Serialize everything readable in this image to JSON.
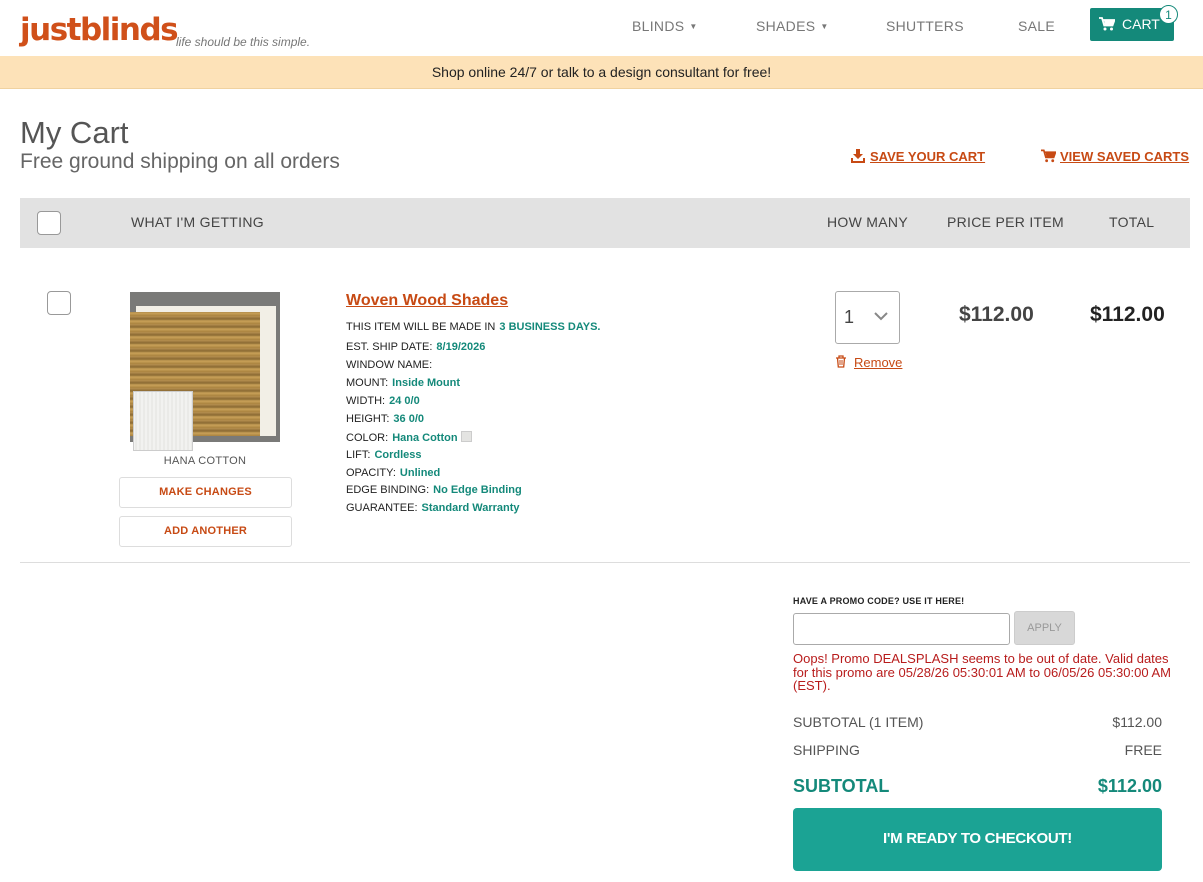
{
  "header": {
    "logo": "justblinds",
    "tagline": "life should be this simple.",
    "nav": [
      "BLINDS",
      "SHADES",
      "SHUTTERS",
      "SALE"
    ],
    "cart_label": "CART",
    "cart_count": "1"
  },
  "banner": {
    "text": "Shop online 24/7 or talk to a design consultant for free!"
  },
  "page": {
    "title": "My Cart",
    "subtitle": "Free ground shipping on all orders",
    "save_cart": "SAVE YOUR CART",
    "view_saved": "VIEW SAVED CARTS"
  },
  "table": {
    "headers": {
      "item": "WHAT I'M GETTING",
      "qty": "HOW MANY",
      "price": "PRICE PER ITEM",
      "total": "TOTAL"
    }
  },
  "item": {
    "name": "Woven Wood Shades",
    "made_in_prefix": "THIS ITEM WILL BE MADE IN",
    "made_in_value": "3 BUSINESS DAYS.",
    "swatch_label": "HANA COTTON",
    "make_changes": "MAKE CHANGES",
    "add_another": "ADD ANOTHER",
    "specs": [
      {
        "label": "EST. SHIP DATE:",
        "value": "8/19/2026"
      },
      {
        "label": "WINDOW NAME:",
        "value": ""
      },
      {
        "label": "MOUNT:",
        "value": "Inside Mount"
      },
      {
        "label": "WIDTH:",
        "value": "24 0/0"
      },
      {
        "label": "HEIGHT:",
        "value": "36 0/0"
      },
      {
        "label": "COLOR:",
        "value": "Hana Cotton"
      },
      {
        "label": "LIFT:",
        "value": "Cordless"
      },
      {
        "label": "OPACITY:",
        "value": "Unlined"
      },
      {
        "label": "EDGE BINDING:",
        "value": "No Edge Binding"
      },
      {
        "label": "GUARANTEE:",
        "value": "Standard Warranty"
      }
    ],
    "quantity": "1",
    "remove": "Remove",
    "price": "$112.00",
    "total": "$112.00"
  },
  "promo": {
    "label": "HAVE A PROMO CODE? USE IT HERE!",
    "input_value": "",
    "apply": "APPLY",
    "error": "Oops! Promo DEALSPLASH seems to be out of date. Valid dates for this promo are 05/28/26 05:30:01 AM to 06/05/26 05:30:00 AM (EST)."
  },
  "summary": {
    "subtotal_items_label": "SUBTOTAL (1 ITEM)",
    "subtotal_items_value": "$112.00",
    "shipping_label": "SHIPPING",
    "shipping_value": "FREE",
    "subtotal_label": "SUBTOTAL",
    "subtotal_value": "$112.00"
  },
  "checkout_button": "I'M READY TO CHECKOUT!",
  "colors": {
    "brand_orange": "#d0501a",
    "teal": "#14897a",
    "checkout_teal": "#1ba394",
    "banner": "#fde2b8",
    "error_red": "#b81c1c"
  }
}
